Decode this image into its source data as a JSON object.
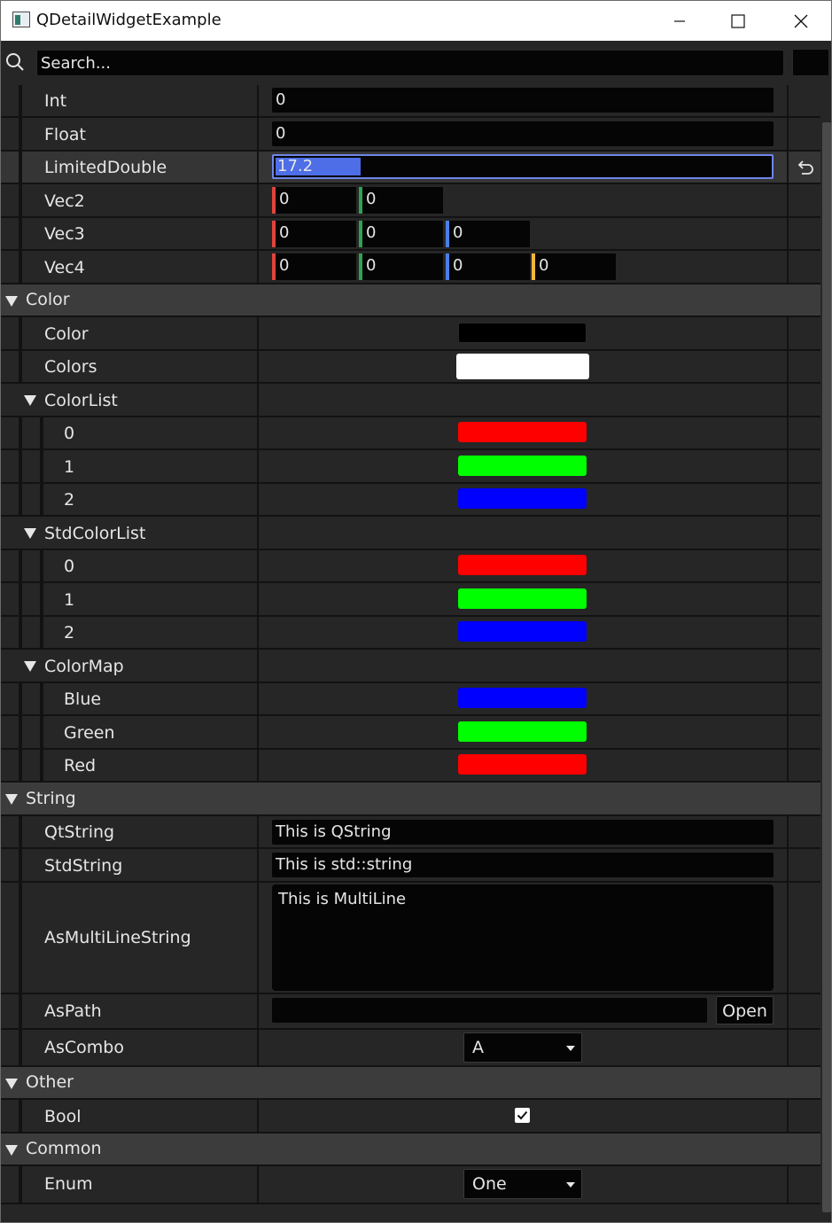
{
  "window": {
    "title": "QDetailWidgetExample"
  },
  "search": {
    "placeholder": "Search..."
  },
  "rows": {
    "int": {
      "label": "Int",
      "value": "0"
    },
    "float": {
      "label": "Float",
      "value": "0"
    },
    "limited_double": {
      "label": "LimitedDouble",
      "value": "17.2"
    },
    "vec2": {
      "label": "Vec2",
      "values": [
        "0",
        "0"
      ]
    },
    "vec3": {
      "label": "Vec3",
      "values": [
        "0",
        "0",
        "0"
      ]
    },
    "vec4": {
      "label": "Vec4",
      "values": [
        "0",
        "0",
        "0",
        "0"
      ]
    }
  },
  "groups": {
    "color": {
      "label": "Color",
      "color": {
        "label": "Color",
        "value": "#000000"
      },
      "colors": {
        "label": "Colors",
        "value": "#ffffff"
      },
      "color_list": {
        "label": "ColorList",
        "items": [
          {
            "key": "0",
            "color": "#ff0000"
          },
          {
            "key": "1",
            "color": "#00ff00"
          },
          {
            "key": "2",
            "color": "#0000ff"
          }
        ]
      },
      "std_color_list": {
        "label": "StdColorList",
        "items": [
          {
            "key": "0",
            "color": "#ff0000"
          },
          {
            "key": "1",
            "color": "#00ff00"
          },
          {
            "key": "2",
            "color": "#0000ff"
          }
        ]
      },
      "color_map": {
        "label": "ColorMap",
        "items": [
          {
            "key": "Blue",
            "color": "#0000ff"
          },
          {
            "key": "Green",
            "color": "#00ff00"
          },
          {
            "key": "Red",
            "color": "#ff0000"
          }
        ]
      }
    },
    "string": {
      "label": "String",
      "qt_string": {
        "label": "QtString",
        "value": "This is QString"
      },
      "std_string": {
        "label": "StdString",
        "value": "This is std::string"
      },
      "multiline": {
        "label": "AsMultiLineString",
        "value": "This is MultiLine"
      },
      "path": {
        "label": "AsPath",
        "value": "",
        "button": "Open"
      },
      "combo": {
        "label": "AsCombo",
        "value": "A"
      }
    },
    "other": {
      "label": "Other",
      "bool": {
        "label": "Bool",
        "checked": true
      }
    },
    "common": {
      "label": "Common",
      "enum": {
        "label": "Enum",
        "value": "One"
      }
    }
  },
  "vec_axis_colors": [
    "#e0443a",
    "#2fa34f",
    "#4a7fe6",
    "#f2b63c"
  ]
}
